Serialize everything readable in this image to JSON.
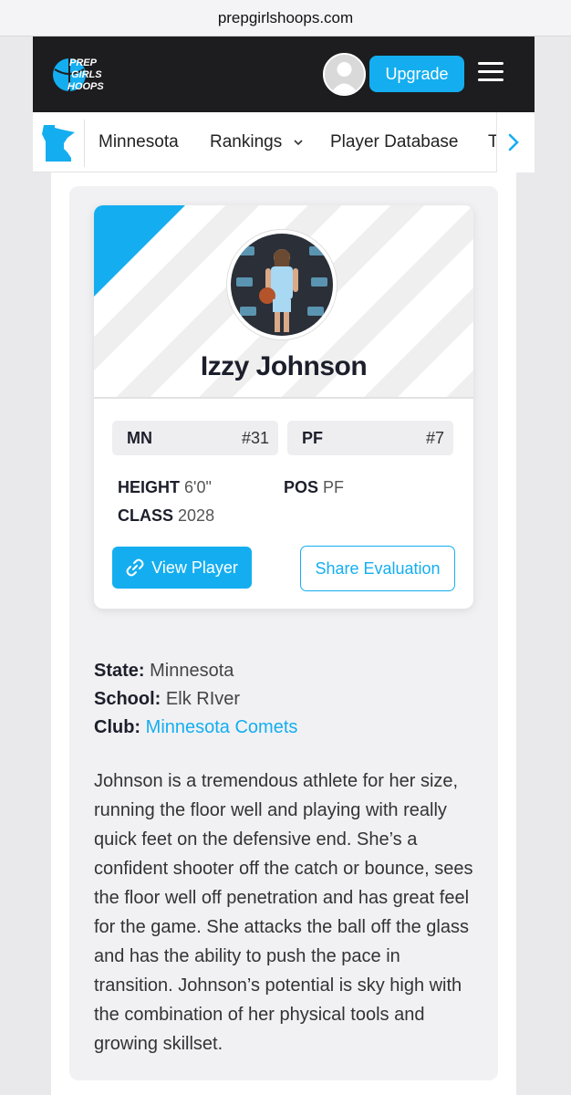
{
  "browser": {
    "url": "prepgirlshoops.com"
  },
  "header": {
    "logo_lines": [
      "PREP",
      "GIRLS",
      "HOOPS"
    ],
    "upgrade_label": "Upgrade"
  },
  "subnav": {
    "items": [
      {
        "label": "Minnesota"
      },
      {
        "label": "Rankings"
      },
      {
        "label": "Player Database"
      },
      {
        "label": "T"
      }
    ]
  },
  "player": {
    "name": "Izzy Johnson",
    "state_code": "MN",
    "state_rank": "#31",
    "position_code": "PF",
    "position_rank": "#7",
    "height_label": "HEIGHT",
    "height_value": "6'0\"",
    "pos_label": "POS",
    "pos_value": "PF",
    "class_label": "CLASS",
    "class_value": "2028",
    "view_label": "View Player",
    "share_label": "Share Evaluation"
  },
  "details": {
    "state_label": "State:",
    "state_value": "Minnesota",
    "school_label": "School:",
    "school_value": "Elk RIver",
    "club_label": "Club:",
    "club_value": "Minnesota Comets"
  },
  "bio": "Johnson is a tremendous athlete for her size, running the floor well and playing with really quick feet on the defensive end. She’s a confident shooter off the catch or bounce, sees the floor well off penetration and has great feel for the game. She attacks the ball off the glass and has the ability to push the pace in transition. Johnson’s potential is sky high with the combination of her physical tools and growing skillset.",
  "colors": {
    "accent": "#14aef0",
    "header_bg": "#1d1d1f"
  }
}
